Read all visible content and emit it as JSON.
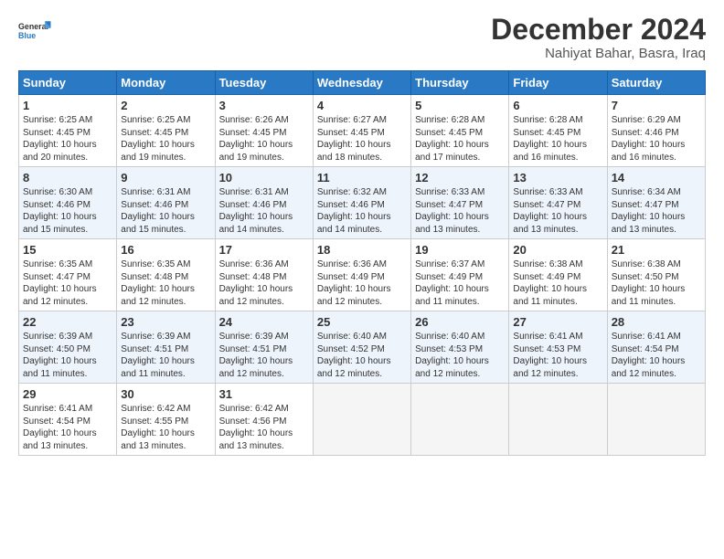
{
  "header": {
    "logo_line1": "General",
    "logo_line2": "Blue",
    "title": "December 2024",
    "subtitle": "Nahiyat Bahar, Basra, Iraq"
  },
  "days_of_week": [
    "Sunday",
    "Monday",
    "Tuesday",
    "Wednesday",
    "Thursday",
    "Friday",
    "Saturday"
  ],
  "weeks": [
    [
      {
        "day": 1,
        "sunrise": "6:25 AM",
        "sunset": "4:45 PM",
        "daylight": "10 hours and 20 minutes."
      },
      {
        "day": 2,
        "sunrise": "6:25 AM",
        "sunset": "4:45 PM",
        "daylight": "10 hours and 19 minutes."
      },
      {
        "day": 3,
        "sunrise": "6:26 AM",
        "sunset": "4:45 PM",
        "daylight": "10 hours and 19 minutes."
      },
      {
        "day": 4,
        "sunrise": "6:27 AM",
        "sunset": "4:45 PM",
        "daylight": "10 hours and 18 minutes."
      },
      {
        "day": 5,
        "sunrise": "6:28 AM",
        "sunset": "4:45 PM",
        "daylight": "10 hours and 17 minutes."
      },
      {
        "day": 6,
        "sunrise": "6:28 AM",
        "sunset": "4:45 PM",
        "daylight": "10 hours and 16 minutes."
      },
      {
        "day": 7,
        "sunrise": "6:29 AM",
        "sunset": "4:46 PM",
        "daylight": "10 hours and 16 minutes."
      }
    ],
    [
      {
        "day": 8,
        "sunrise": "6:30 AM",
        "sunset": "4:46 PM",
        "daylight": "10 hours and 15 minutes."
      },
      {
        "day": 9,
        "sunrise": "6:31 AM",
        "sunset": "4:46 PM",
        "daylight": "10 hours and 15 minutes."
      },
      {
        "day": 10,
        "sunrise": "6:31 AM",
        "sunset": "4:46 PM",
        "daylight": "10 hours and 14 minutes."
      },
      {
        "day": 11,
        "sunrise": "6:32 AM",
        "sunset": "4:46 PM",
        "daylight": "10 hours and 14 minutes."
      },
      {
        "day": 12,
        "sunrise": "6:33 AM",
        "sunset": "4:47 PM",
        "daylight": "10 hours and 13 minutes."
      },
      {
        "day": 13,
        "sunrise": "6:33 AM",
        "sunset": "4:47 PM",
        "daylight": "10 hours and 13 minutes."
      },
      {
        "day": 14,
        "sunrise": "6:34 AM",
        "sunset": "4:47 PM",
        "daylight": "10 hours and 13 minutes."
      }
    ],
    [
      {
        "day": 15,
        "sunrise": "6:35 AM",
        "sunset": "4:47 PM",
        "daylight": "10 hours and 12 minutes."
      },
      {
        "day": 16,
        "sunrise": "6:35 AM",
        "sunset": "4:48 PM",
        "daylight": "10 hours and 12 minutes."
      },
      {
        "day": 17,
        "sunrise": "6:36 AM",
        "sunset": "4:48 PM",
        "daylight": "10 hours and 12 minutes."
      },
      {
        "day": 18,
        "sunrise": "6:36 AM",
        "sunset": "4:49 PM",
        "daylight": "10 hours and 12 minutes."
      },
      {
        "day": 19,
        "sunrise": "6:37 AM",
        "sunset": "4:49 PM",
        "daylight": "10 hours and 11 minutes."
      },
      {
        "day": 20,
        "sunrise": "6:38 AM",
        "sunset": "4:49 PM",
        "daylight": "10 hours and 11 minutes."
      },
      {
        "day": 21,
        "sunrise": "6:38 AM",
        "sunset": "4:50 PM",
        "daylight": "10 hours and 11 minutes."
      }
    ],
    [
      {
        "day": 22,
        "sunrise": "6:39 AM",
        "sunset": "4:50 PM",
        "daylight": "10 hours and 11 minutes."
      },
      {
        "day": 23,
        "sunrise": "6:39 AM",
        "sunset": "4:51 PM",
        "daylight": "10 hours and 11 minutes."
      },
      {
        "day": 24,
        "sunrise": "6:39 AM",
        "sunset": "4:51 PM",
        "daylight": "10 hours and 12 minutes."
      },
      {
        "day": 25,
        "sunrise": "6:40 AM",
        "sunset": "4:52 PM",
        "daylight": "10 hours and 12 minutes."
      },
      {
        "day": 26,
        "sunrise": "6:40 AM",
        "sunset": "4:53 PM",
        "daylight": "10 hours and 12 minutes."
      },
      {
        "day": 27,
        "sunrise": "6:41 AM",
        "sunset": "4:53 PM",
        "daylight": "10 hours and 12 minutes."
      },
      {
        "day": 28,
        "sunrise": "6:41 AM",
        "sunset": "4:54 PM",
        "daylight": "10 hours and 12 minutes."
      }
    ],
    [
      {
        "day": 29,
        "sunrise": "6:41 AM",
        "sunset": "4:54 PM",
        "daylight": "10 hours and 13 minutes."
      },
      {
        "day": 30,
        "sunrise": "6:42 AM",
        "sunset": "4:55 PM",
        "daylight": "10 hours and 13 minutes."
      },
      {
        "day": 31,
        "sunrise": "6:42 AM",
        "sunset": "4:56 PM",
        "daylight": "10 hours and 13 minutes."
      },
      null,
      null,
      null,
      null
    ]
  ],
  "labels": {
    "sunrise": "Sunrise:",
    "sunset": "Sunset:",
    "daylight": "Daylight:"
  }
}
